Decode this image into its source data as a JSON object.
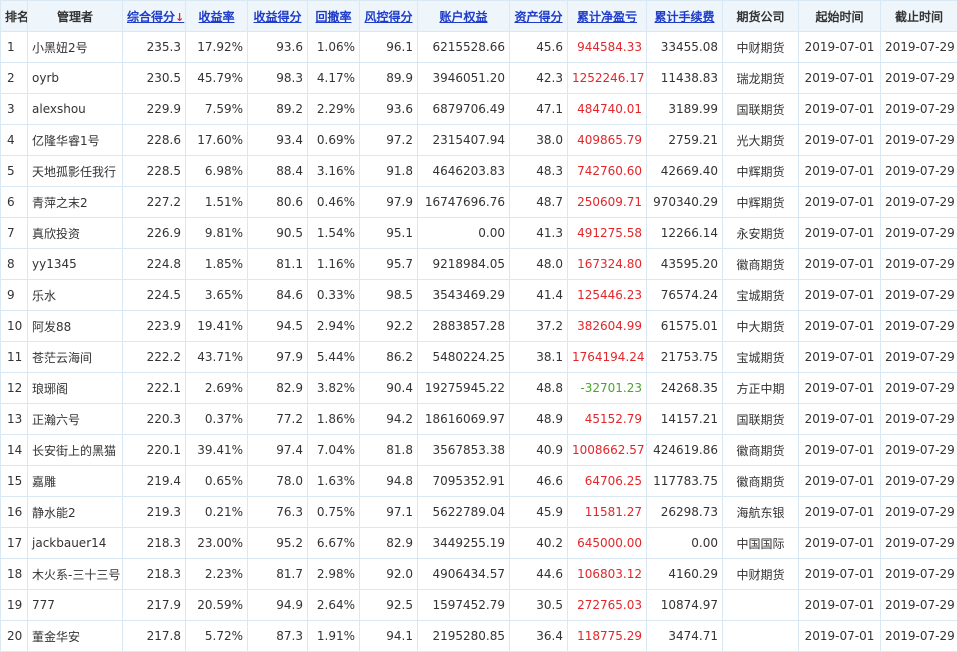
{
  "headers": {
    "rank": "排名",
    "manager": "管理者",
    "composite": "综合得分",
    "composite_arrow": "↓",
    "return_rate": "收益率",
    "return_score": "收益得分",
    "drawdown": "回撤率",
    "risk_score": "风控得分",
    "equity": "账户权益",
    "asset_score": "资产得分",
    "net_pnl": "累计净盈亏",
    "fees": "累计手续费",
    "broker": "期货公司",
    "start": "起始时间",
    "end": "截止时间"
  },
  "rows": [
    {
      "rank": "1",
      "manager": "小黑妞2号",
      "composite": "235.3",
      "return_rate": "17.92%",
      "return_score": "93.6",
      "drawdown": "1.06%",
      "risk_score": "96.1",
      "equity": "6215528.66",
      "asset_score": "45.6",
      "net_pnl": "944584.33",
      "pnl_sign": "pos",
      "fees": "33455.08",
      "broker": "中财期货",
      "start": "2019-07-01",
      "end": "2019-07-29"
    },
    {
      "rank": "2",
      "manager": "oyrb",
      "composite": "230.5",
      "return_rate": "45.79%",
      "return_score": "98.3",
      "drawdown": "4.17%",
      "risk_score": "89.9",
      "equity": "3946051.20",
      "asset_score": "42.3",
      "net_pnl": "1252246.17",
      "pnl_sign": "pos",
      "fees": "11438.83",
      "broker": "瑞龙期货",
      "start": "2019-07-01",
      "end": "2019-07-29"
    },
    {
      "rank": "3",
      "manager": "alexshou",
      "composite": "229.9",
      "return_rate": "7.59%",
      "return_score": "89.2",
      "drawdown": "2.29%",
      "risk_score": "93.6",
      "equity": "6879706.49",
      "asset_score": "47.1",
      "net_pnl": "484740.01",
      "pnl_sign": "pos",
      "fees": "3189.99",
      "broker": "国联期货",
      "start": "2019-07-01",
      "end": "2019-07-29"
    },
    {
      "rank": "4",
      "manager": "亿隆华睿1号",
      "composite": "228.6",
      "return_rate": "17.60%",
      "return_score": "93.4",
      "drawdown": "0.69%",
      "risk_score": "97.2",
      "equity": "2315407.94",
      "asset_score": "38.0",
      "net_pnl": "409865.79",
      "pnl_sign": "pos",
      "fees": "2759.21",
      "broker": "光大期货",
      "start": "2019-07-01",
      "end": "2019-07-29"
    },
    {
      "rank": "5",
      "manager": "天地孤影任我行",
      "composite": "228.5",
      "return_rate": "6.98%",
      "return_score": "88.4",
      "drawdown": "3.16%",
      "risk_score": "91.8",
      "equity": "4646203.83",
      "asset_score": "48.3",
      "net_pnl": "742760.60",
      "pnl_sign": "pos",
      "fees": "42669.40",
      "broker": "中辉期货",
      "start": "2019-07-01",
      "end": "2019-07-29"
    },
    {
      "rank": "6",
      "manager": "青萍之末2",
      "composite": "227.2",
      "return_rate": "1.51%",
      "return_score": "80.6",
      "drawdown": "0.46%",
      "risk_score": "97.9",
      "equity": "16747696.76",
      "asset_score": "48.7",
      "net_pnl": "250609.71",
      "pnl_sign": "pos",
      "fees": "970340.29",
      "broker": "中辉期货",
      "start": "2019-07-01",
      "end": "2019-07-29"
    },
    {
      "rank": "7",
      "manager": "真欣投资",
      "composite": "226.9",
      "return_rate": "9.81%",
      "return_score": "90.5",
      "drawdown": "1.54%",
      "risk_score": "95.1",
      "equity": "0.00",
      "asset_score": "41.3",
      "net_pnl": "491275.58",
      "pnl_sign": "pos",
      "fees": "12266.14",
      "broker": "永安期货",
      "start": "2019-07-01",
      "end": "2019-07-29"
    },
    {
      "rank": "8",
      "manager": "yy1345",
      "composite": "224.8",
      "return_rate": "1.85%",
      "return_score": "81.1",
      "drawdown": "1.16%",
      "risk_score": "95.7",
      "equity": "9218984.05",
      "asset_score": "48.0",
      "net_pnl": "167324.80",
      "pnl_sign": "pos",
      "fees": "43595.20",
      "broker": "徽商期货",
      "start": "2019-07-01",
      "end": "2019-07-29"
    },
    {
      "rank": "9",
      "manager": "乐水",
      "composite": "224.5",
      "return_rate": "3.65%",
      "return_score": "84.6",
      "drawdown": "0.33%",
      "risk_score": "98.5",
      "equity": "3543469.29",
      "asset_score": "41.4",
      "net_pnl": "125446.23",
      "pnl_sign": "pos",
      "fees": "76574.24",
      "broker": "宝城期货",
      "start": "2019-07-01",
      "end": "2019-07-29"
    },
    {
      "rank": "10",
      "manager": "阿发88",
      "composite": "223.9",
      "return_rate": "19.41%",
      "return_score": "94.5",
      "drawdown": "2.94%",
      "risk_score": "92.2",
      "equity": "2883857.28",
      "asset_score": "37.2",
      "net_pnl": "382604.99",
      "pnl_sign": "pos",
      "fees": "61575.01",
      "broker": "中大期货",
      "start": "2019-07-01",
      "end": "2019-07-29"
    },
    {
      "rank": "11",
      "manager": "苍茫云海间",
      "composite": "222.2",
      "return_rate": "43.71%",
      "return_score": "97.9",
      "drawdown": "5.44%",
      "risk_score": "86.2",
      "equity": "5480224.25",
      "asset_score": "38.1",
      "net_pnl": "1764194.24",
      "pnl_sign": "pos",
      "fees": "21753.75",
      "broker": "宝城期货",
      "start": "2019-07-01",
      "end": "2019-07-29"
    },
    {
      "rank": "12",
      "manager": "琅琊阁",
      "composite": "222.1",
      "return_rate": "2.69%",
      "return_score": "82.9",
      "drawdown": "3.82%",
      "risk_score": "90.4",
      "equity": "19275945.22",
      "asset_score": "48.8",
      "net_pnl": "-32701.23",
      "pnl_sign": "neg",
      "fees": "24268.35",
      "broker": "方正中期",
      "start": "2019-07-01",
      "end": "2019-07-29"
    },
    {
      "rank": "13",
      "manager": "正瀚六号",
      "composite": "220.3",
      "return_rate": "0.37%",
      "return_score": "77.2",
      "drawdown": "1.86%",
      "risk_score": "94.2",
      "equity": "18616069.97",
      "asset_score": "48.9",
      "net_pnl": "45152.79",
      "pnl_sign": "pos",
      "fees": "14157.21",
      "broker": "国联期货",
      "start": "2019-07-01",
      "end": "2019-07-29"
    },
    {
      "rank": "14",
      "manager": "长安街上的黑猫",
      "composite": "220.1",
      "return_rate": "39.41%",
      "return_score": "97.4",
      "drawdown": "7.04%",
      "risk_score": "81.8",
      "equity": "3567853.38",
      "asset_score": "40.9",
      "net_pnl": "1008662.57",
      "pnl_sign": "pos",
      "fees": "424619.86",
      "broker": "徽商期货",
      "start": "2019-07-01",
      "end": "2019-07-29"
    },
    {
      "rank": "15",
      "manager": "嘉雕",
      "composite": "219.4",
      "return_rate": "0.65%",
      "return_score": "78.0",
      "drawdown": "1.63%",
      "risk_score": "94.8",
      "equity": "7095352.91",
      "asset_score": "46.6",
      "net_pnl": "64706.25",
      "pnl_sign": "pos",
      "fees": "117783.75",
      "broker": "徽商期货",
      "start": "2019-07-01",
      "end": "2019-07-29"
    },
    {
      "rank": "16",
      "manager": "静水能2",
      "composite": "219.3",
      "return_rate": "0.21%",
      "return_score": "76.3",
      "drawdown": "0.75%",
      "risk_score": "97.1",
      "equity": "5622789.04",
      "asset_score": "45.9",
      "net_pnl": "11581.27",
      "pnl_sign": "pos",
      "fees": "26298.73",
      "broker": "海航东银",
      "start": "2019-07-01",
      "end": "2019-07-29"
    },
    {
      "rank": "17",
      "manager": "jackbauer14",
      "composite": "218.3",
      "return_rate": "23.00%",
      "return_score": "95.2",
      "drawdown": "6.67%",
      "risk_score": "82.9",
      "equity": "3449255.19",
      "asset_score": "40.2",
      "net_pnl": "645000.00",
      "pnl_sign": "pos",
      "fees": "0.00",
      "broker": "中国国际",
      "start": "2019-07-01",
      "end": "2019-07-29"
    },
    {
      "rank": "18",
      "manager": "木火系-三十三号",
      "composite": "218.3",
      "return_rate": "2.23%",
      "return_score": "81.7",
      "drawdown": "2.98%",
      "risk_score": "92.0",
      "equity": "4906434.57",
      "asset_score": "44.6",
      "net_pnl": "106803.12",
      "pnl_sign": "pos",
      "fees": "4160.29",
      "broker": "中财期货",
      "start": "2019-07-01",
      "end": "2019-07-29"
    },
    {
      "rank": "19",
      "manager": "777",
      "composite": "217.9",
      "return_rate": "20.59%",
      "return_score": "94.9",
      "drawdown": "2.64%",
      "risk_score": "92.5",
      "equity": "1597452.79",
      "asset_score": "30.5",
      "net_pnl": "272765.03",
      "pnl_sign": "pos",
      "fees": "10874.97",
      "broker": "",
      "start": "2019-07-01",
      "end": "2019-07-29"
    },
    {
      "rank": "20",
      "manager": "董金华安",
      "composite": "217.8",
      "return_rate": "5.72%",
      "return_score": "87.3",
      "drawdown": "1.91%",
      "risk_score": "94.1",
      "equity": "2195280.85",
      "asset_score": "36.4",
      "net_pnl": "118775.29",
      "pnl_sign": "pos",
      "fees": "3474.71",
      "broker": "",
      "start": "2019-07-01",
      "end": "2019-07-29"
    }
  ]
}
